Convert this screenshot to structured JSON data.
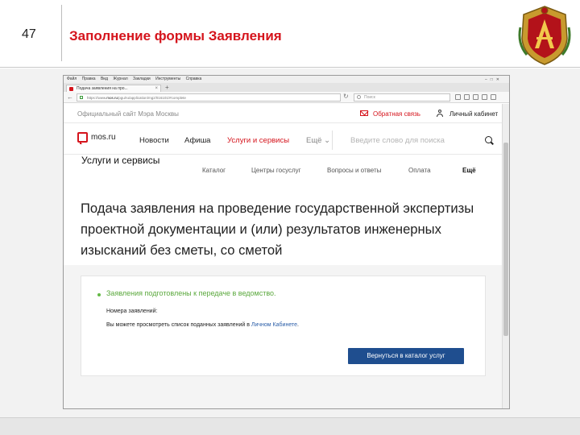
{
  "slide": {
    "number": "47",
    "title": "Заполнение формы Заявления"
  },
  "browser": {
    "menu": [
      "Файл",
      "Правка",
      "Вид",
      "Журнал",
      "Закладки",
      "Инструменты",
      "Справка"
    ],
    "tab_title": "Подача заявления на про...",
    "url_host": "mos.ru",
    "url_prefix": "https://www.",
    "url_rest": "/pgu/ru/application/mgz/016101/#complete",
    "search_placeholder": "Поиск"
  },
  "site": {
    "official": "Официальный сайт Мэра Москвы",
    "feedback": "Обратная связь",
    "cabinet": "Личный кабинет",
    "logo": "mos.ru",
    "nav": [
      "Новости",
      "Афиша",
      "Услуги и сервисы"
    ],
    "nav_more": "Ещё ⌄",
    "search_placeholder": "Введите слово для поиска",
    "section_title": "Услуги и сервисы",
    "subnav": [
      "Каталог",
      "Центры госуслуг",
      "Вопросы и ответы",
      "Оплата",
      "Ещё"
    ],
    "headline": "Подача заявления на проведение государственной экспертизы проектной документации и (или) результатов инженерных изысканий без сметы, со сметой",
    "status": "Заявления подготовлены к передаче в ведомство.",
    "numbers_label": "Номера заявлений:",
    "view_text_before": "Вы можете просмотреть список поданных заявлений в ",
    "view_link": "Личном Кабинете",
    "view_text_after": ".",
    "back_button": "Вернуться в каталог услуг"
  },
  "colors": {
    "accent_red": "#d5141c",
    "success_green": "#5aa83c",
    "button_blue": "#1f4e8f",
    "link_blue": "#2b5ea8"
  }
}
